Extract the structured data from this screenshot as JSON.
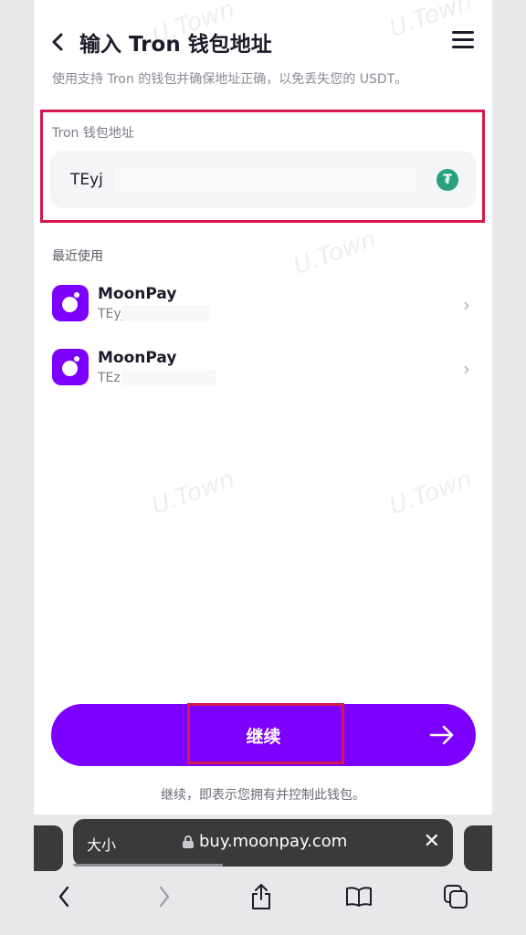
{
  "header": {
    "title": "输入 Tron 钱包地址",
    "subtitle": "使用支持 Tron 的钱包并确保地址正确，以免丢失您的 USDT。"
  },
  "wallet_field": {
    "label": "Tron 钱包地址",
    "value": "TEyj"
  },
  "recent": {
    "title": "最近使用",
    "items": [
      {
        "name": "MoonPay",
        "address": "TEyj"
      },
      {
        "name": "MoonPay",
        "address": "TEz"
      }
    ]
  },
  "continue_button": {
    "label": "继续",
    "accent": "#7d00ff"
  },
  "footer": {
    "note": "继续，即表示您拥有并控制此钱包。"
  },
  "watermark": "U.Town",
  "browser": {
    "text_size_label": "大小",
    "url": "buy.moonpay.com"
  },
  "colors": {
    "accent": "#7d00ff",
    "highlight": "#d6184a",
    "tether": "#26a17b"
  }
}
